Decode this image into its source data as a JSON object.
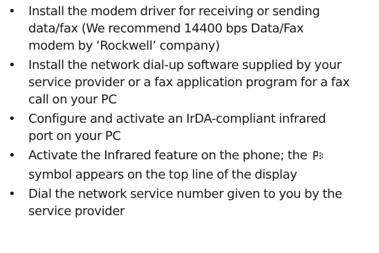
{
  "instructions": [
    {
      "lines": [
        "Install the modem driver for receiving or sending",
        "data/fax (We recommend 14400 bps Data/Fax",
        "modem by ‘Rockwell’ company)"
      ]
    },
    {
      "lines": [
        "Install the network dial-up software supplied by your",
        "service provider or a fax application program for a fax",
        "call on your PC"
      ]
    },
    {
      "lines": [
        "Configure and activate an IrDA-compliant infrared",
        "port on your PC"
      ]
    },
    {
      "lines_part": {
        "line1_before_icon": "Activate the Infrared feature on the phone; the",
        "line2": "symbol appears on the top line of the display"
      },
      "icon": "infrared-icon"
    },
    {
      "lines": [
        "Dial the network service number given to you by the",
        "service provider"
      ]
    }
  ],
  "bullet_char": "•"
}
